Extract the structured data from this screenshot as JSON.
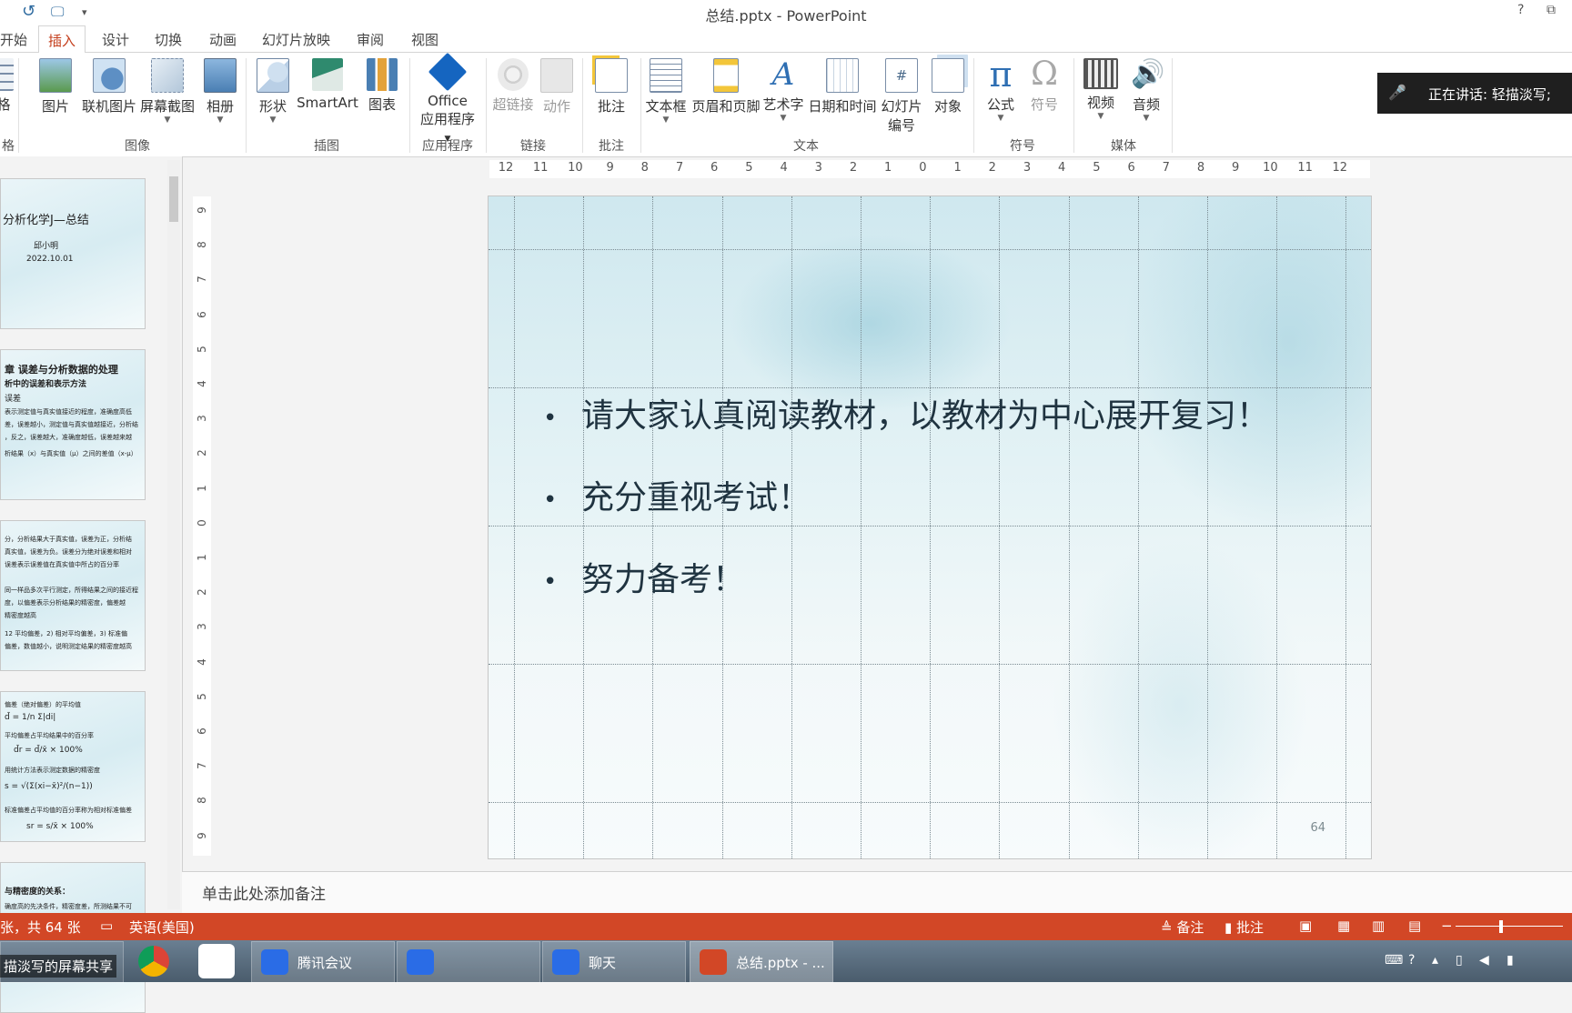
{
  "window": {
    "title": "总结.pptx - PowerPoint",
    "help": "?",
    "restore": "⧉"
  },
  "quick_access": [
    "↺",
    "🖵",
    "▾"
  ],
  "tabs": [
    {
      "label": "开始"
    },
    {
      "label": "插入",
      "active": true
    },
    {
      "label": "设计"
    },
    {
      "label": "切换"
    },
    {
      "label": "动画"
    },
    {
      "label": "幻灯片放映"
    },
    {
      "label": "审阅"
    },
    {
      "label": "视图"
    }
  ],
  "ribbon": {
    "table_group_label": "格",
    "table_group_caption": "格",
    "images": {
      "group": "图像",
      "picture": "图片",
      "online_picture": "联机图片",
      "screenshot": "屏幕截图",
      "album": "相册"
    },
    "illustrations": {
      "group": "插图",
      "shapes": "形状",
      "smartart": "SmartArt",
      "chart": "图表"
    },
    "apps": {
      "group": "应用程序",
      "office_line1": "Office",
      "office_line2": "应用程序"
    },
    "links": {
      "group": "链接",
      "hyperlink": "超链接",
      "action": "动作"
    },
    "comments": {
      "group": "批注",
      "comment": "批注"
    },
    "text": {
      "group": "文本",
      "textbox": "文本框",
      "header_footer": "页眉和页脚",
      "wordart": "艺术字",
      "datetime": "日期和时间",
      "slide_number_line1": "幻灯片",
      "slide_number_line2": "编号",
      "object": "对象"
    },
    "symbols": {
      "group": "符号",
      "equation": "公式",
      "symbol": "符号"
    },
    "media": {
      "group": "媒体",
      "video": "视频",
      "audio": "音频"
    }
  },
  "speaking_indicator": "正在讲话: 轻描淡写;",
  "thumbnails": [
    {
      "lines": [
        "分析化学J—总结",
        "邱小明",
        "2022.10.01"
      ]
    },
    {
      "lines": [
        "章 误差与分析数据的处理",
        "析中的误差和表示方法",
        "误差",
        "表示测定值与真实值接近的程度，准确度高低",
        "差，误差越小，测定值与真实值越接近，分析结",
        "，反之，误差越大，准确度越低，误差越来越",
        "析结果（x）与真实值（μ）之间的差值（x-μ）"
      ]
    },
    {
      "lines": [
        "分，分析结果大于真实值，误差为正，分析结",
        "真实值，误差为负。误差分为绝对误差和相对",
        "误差表示误差值在真实值中所占的百分率",
        "",
        "同一样品多次平行测定，所得结果之间的接近程",
        "度，以偏差表示分析结果的精密度，偏差越",
        "精密度越高",
        "12 平均偏差，2) 相对平均偏差，3) 标准偏",
        "偏差，数值越小，说明测定结果的精密度越高"
      ]
    },
    {
      "lines": [
        "偏差（绝对偏差）的平均值",
        "d̄ = 1/n Σ|di|",
        "平均偏差占平均结果中的百分率",
        "d̄r = d̄/x̄ × 100%",
        "用统计方法表示测定数据的精密度",
        "s = √(Σ(xi−x̄)²/(n−1))",
        "标准偏差占平均值的百分率称为相对标准偏差",
        "sr = s/x̄ × 100%"
      ]
    },
    {
      "lines": [
        "与精密度的关系：",
        "确度高的先决条件，精密度差，所测结果不可"
      ]
    }
  ],
  "slide": {
    "bullets": [
      "请大家认真阅读教材，以教材为中心展开复习！",
      "充分重视考试！",
      "努力备考！"
    ],
    "bullet_symbol": "•",
    "page_number": "64"
  },
  "rulers": {
    "horizontal": [
      "12",
      "11",
      "10",
      "9",
      "8",
      "7",
      "6",
      "5",
      "4",
      "3",
      "2",
      "1",
      "0",
      "1",
      "2",
      "3",
      "4",
      "5",
      "6",
      "7",
      "8",
      "9",
      "10",
      "11",
      "12"
    ],
    "vertical": [
      "9",
      "8",
      "7",
      "6",
      "5",
      "4",
      "3",
      "2",
      "1",
      "0",
      "1",
      "2",
      "3",
      "4",
      "5",
      "6",
      "7",
      "8",
      "9"
    ]
  },
  "notes_placeholder": "单击此处添加备注",
  "status_bar": {
    "slide_info": "张，共 64 张",
    "language": "英语(美国)",
    "notes": "备注",
    "comments": "批注",
    "colors": {
      "bar": "#d24726"
    }
  },
  "taskbar": {
    "share_label": "描淡写的屏幕共享",
    "tencent_meeting": "腾讯会议",
    "chat": "聊天",
    "powerpoint": "总结.pptx - ..."
  }
}
